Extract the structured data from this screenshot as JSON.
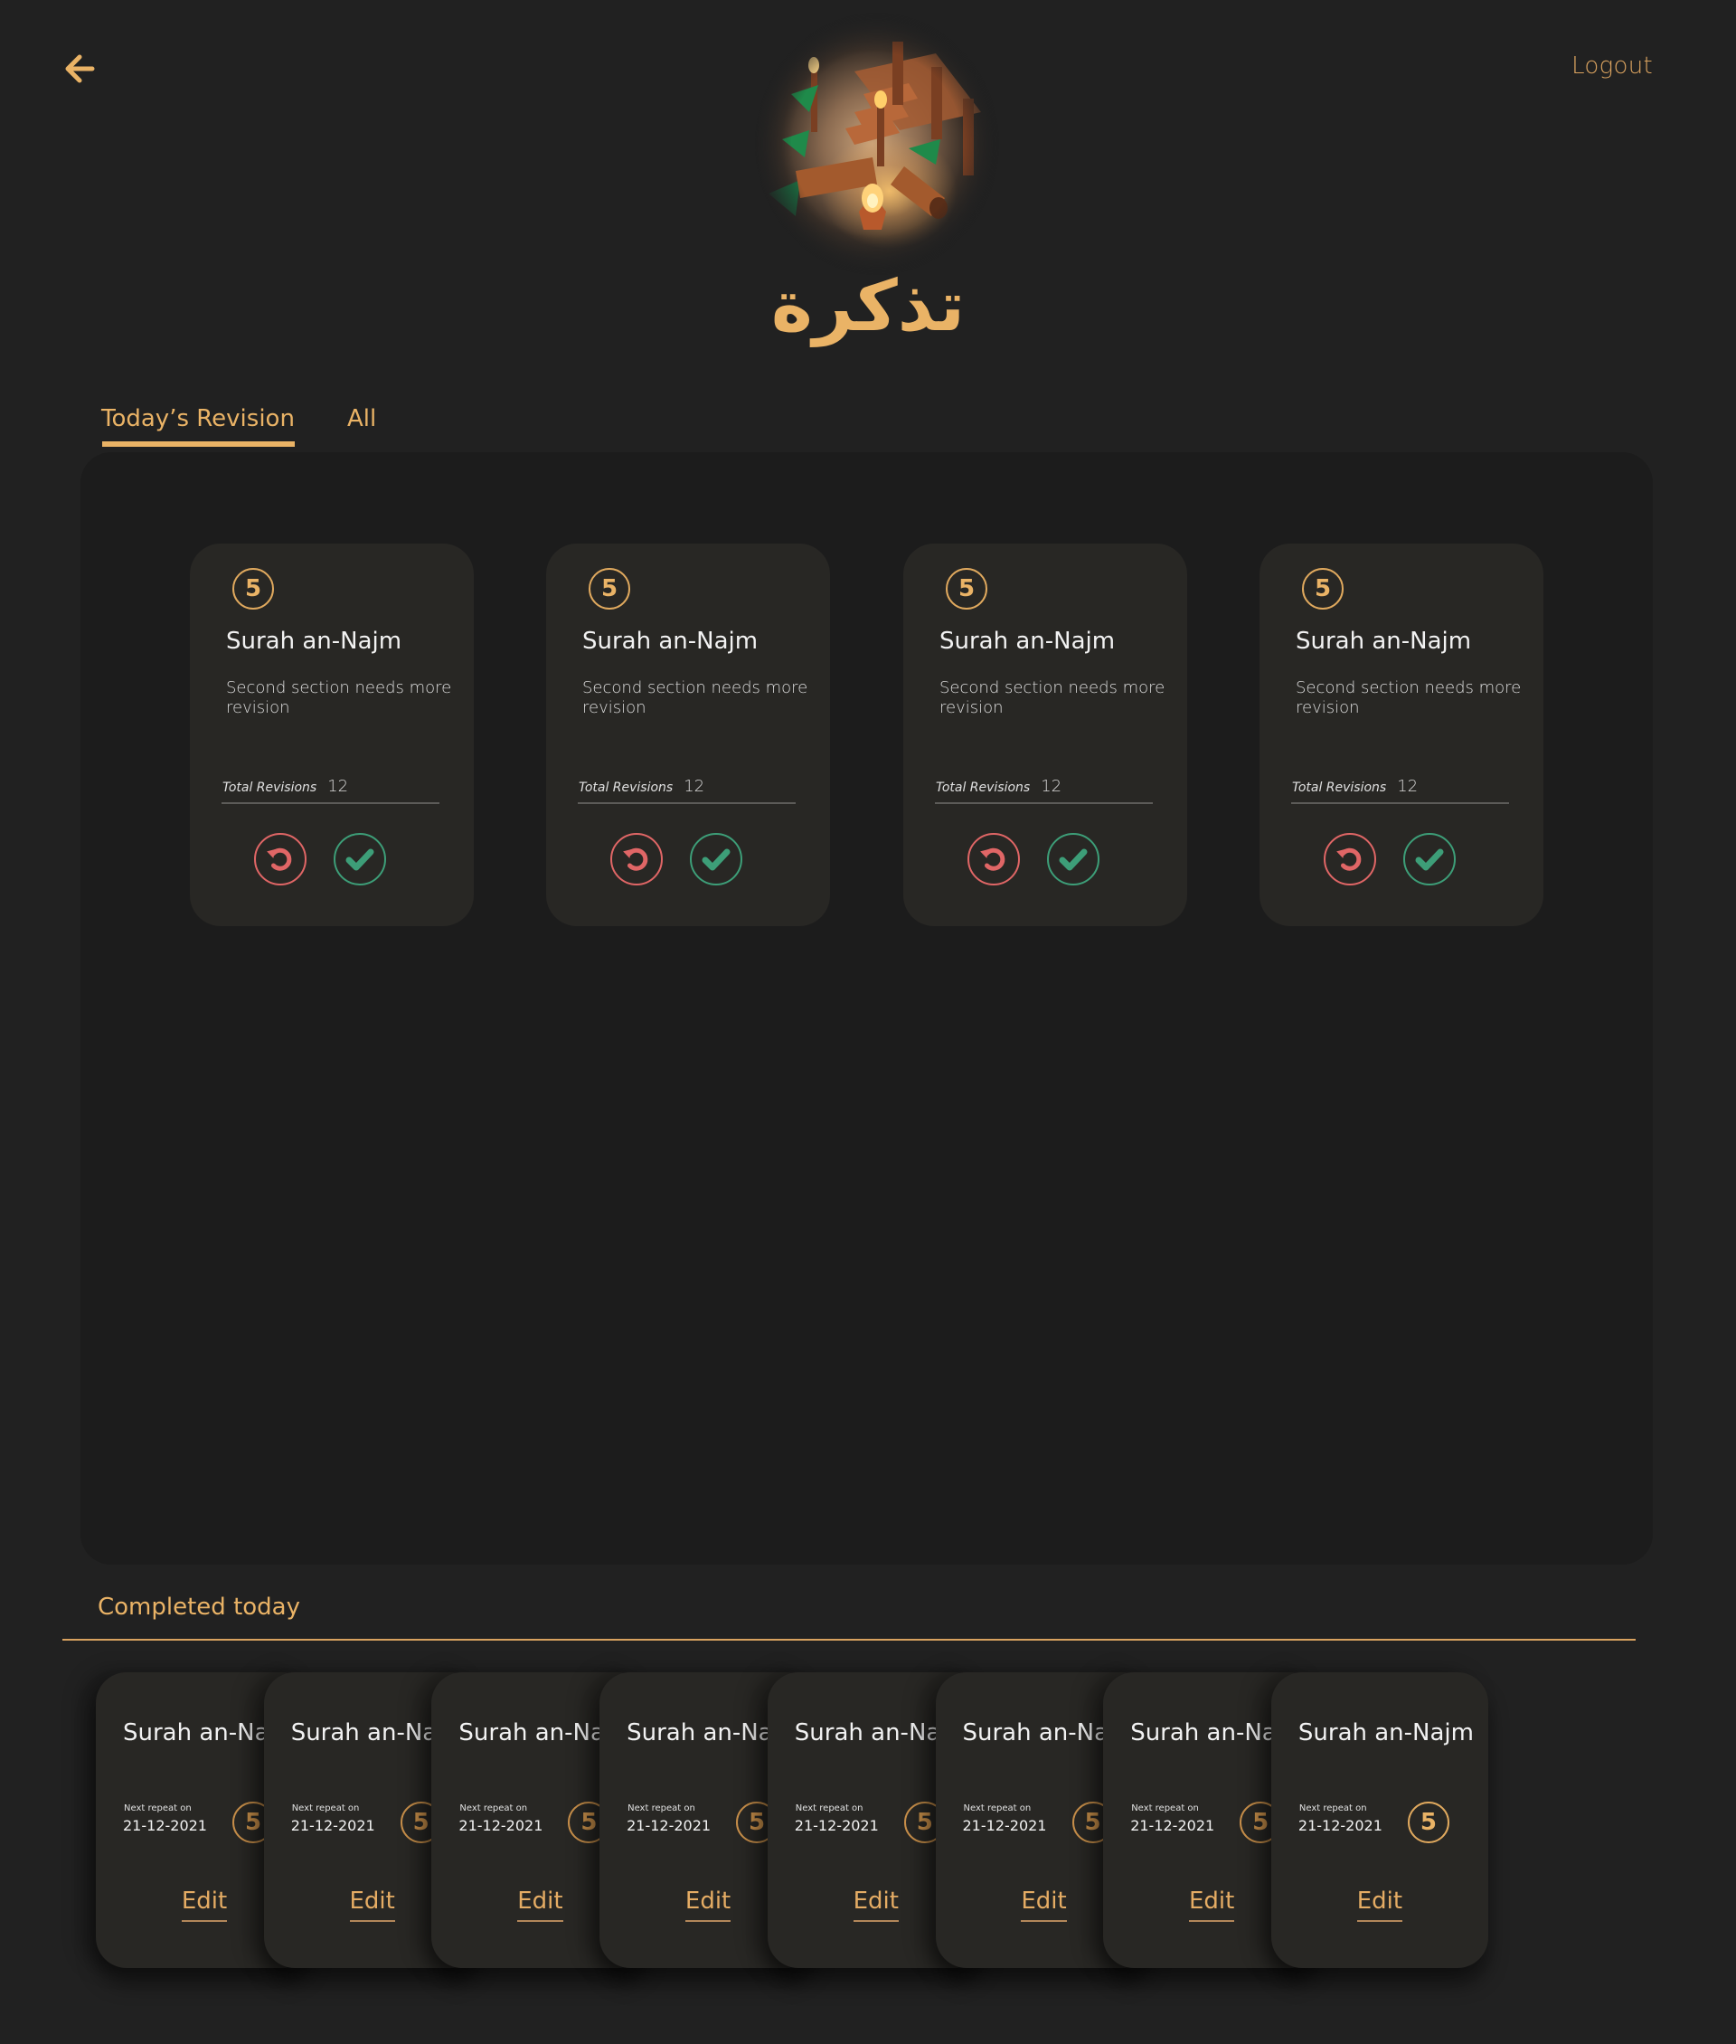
{
  "header": {
    "back_icon": "arrow-left-icon",
    "logout_label": "Logout",
    "logo_alt": "campfire-scene-logo",
    "app_title": "تذكرة"
  },
  "tabs": [
    {
      "label": "Today’s Revision",
      "active": true
    },
    {
      "label": "All",
      "active": false
    }
  ],
  "today_revision": {
    "cards": [
      {
        "badge": "5",
        "title": "Surah an-Najm",
        "note": "Second section needs more revision",
        "total_label": "Total Revisions",
        "total_value": "12",
        "redo_icon": "redo-icon",
        "done_icon": "check-icon"
      },
      {
        "badge": "5",
        "title": "Surah an-Najm",
        "note": "Second section needs more revision",
        "total_label": "Total Revisions",
        "total_value": "12",
        "redo_icon": "redo-icon",
        "done_icon": "check-icon"
      },
      {
        "badge": "5",
        "title": "Surah an-Najm",
        "note": "Second section needs more revision",
        "total_label": "Total Revisions",
        "total_value": "12",
        "redo_icon": "redo-icon",
        "done_icon": "check-icon"
      },
      {
        "badge": "5",
        "title": "Surah an-Najm",
        "note": "Second section needs more revision",
        "total_label": "Total Revisions",
        "total_value": "12",
        "redo_icon": "redo-icon",
        "done_icon": "check-icon"
      }
    ]
  },
  "completed": {
    "title": "Completed today",
    "cards": [
      {
        "title": "Surah an-Najm",
        "next_label": "Next repeat on",
        "next_date": "21-12-2021",
        "badge": "5",
        "edit_label": "Edit"
      },
      {
        "title": "Surah an-Najm",
        "next_label": "Next repeat on",
        "next_date": "21-12-2021",
        "badge": "5",
        "edit_label": "Edit"
      },
      {
        "title": "Surah an-Najm",
        "next_label": "Next repeat on",
        "next_date": "21-12-2021",
        "badge": "5",
        "edit_label": "Edit"
      },
      {
        "title": "Surah an-Najm",
        "next_label": "Next repeat on",
        "next_date": "21-12-2021",
        "badge": "5",
        "edit_label": "Edit"
      },
      {
        "title": "Surah an-Najm",
        "next_label": "Next repeat on",
        "next_date": "21-12-2021",
        "badge": "5",
        "edit_label": "Edit"
      },
      {
        "title": "Surah an-Najm",
        "next_label": "Next repeat on",
        "next_date": "21-12-2021",
        "badge": "5",
        "edit_label": "Edit"
      },
      {
        "title": "Surah an-Najm",
        "next_label": "Next repeat on",
        "next_date": "21-12-2021",
        "badge": "5",
        "edit_label": "Edit"
      },
      {
        "title": "Surah an-Najm",
        "next_label": "Next repeat on",
        "next_date": "21-12-2021",
        "badge": "5",
        "edit_label": "Edit"
      }
    ]
  },
  "colors": {
    "accent": "#eab366",
    "background": "#212121",
    "panel": "#1c1c1c",
    "card": "#282724",
    "redo": "#e06666",
    "done": "#3d9e78"
  }
}
